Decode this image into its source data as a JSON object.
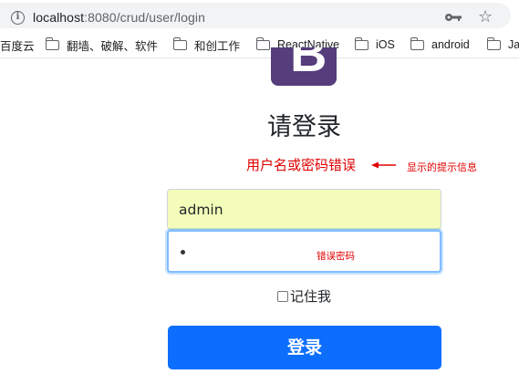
{
  "browser": {
    "url_host": "localhost",
    "url_path": ":8080/crud/user/login",
    "icons": {
      "info": "info-icon",
      "key": "key-icon",
      "star": "star-icon"
    }
  },
  "bookmarks": [
    {
      "label": "百度云",
      "icon": "none"
    },
    {
      "label": "翻墙、破解、软件",
      "icon": "folder-icon"
    },
    {
      "label": "和创工作",
      "icon": "folder-icon"
    },
    {
      "label": "ReactNative",
      "icon": "folder-icon"
    },
    {
      "label": "iOS",
      "icon": "folder-icon"
    },
    {
      "label": "android",
      "icon": "folder-icon"
    },
    {
      "label": "Ja",
      "icon": "folder-icon"
    }
  ],
  "logo": {
    "letter": "B",
    "color": "#563d7c"
  },
  "page": {
    "title": "请登录",
    "error_message": "用户名或密码错误",
    "annotation_error": "显示的提示信息",
    "username_value": "admin",
    "annotation_password": "错误密码",
    "remember_label": "记住我",
    "remember_checked": false,
    "submit_label": "登录"
  },
  "colors": {
    "error": "#e00000",
    "primary": "#0d6efd",
    "autofill": "#f3fdb9"
  }
}
